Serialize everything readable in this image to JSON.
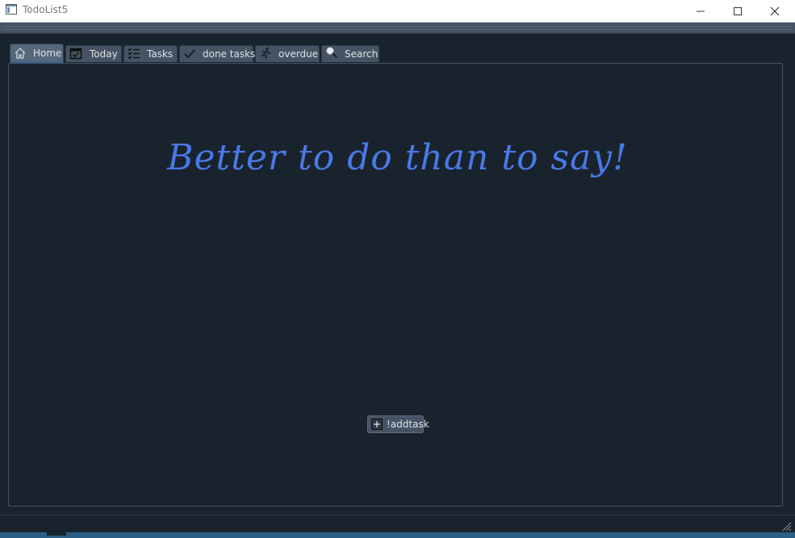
{
  "window": {
    "title": "TodoList5",
    "icon": "app-window-icon",
    "controls": {
      "minimize": "minimize-icon",
      "maximize": "maximize-icon",
      "close": "close-icon"
    }
  },
  "tabs": [
    {
      "label": "Home",
      "icon": "home-icon",
      "active": true
    },
    {
      "label": "Today",
      "icon": "calendar-check-icon",
      "active": false
    },
    {
      "label": "Tasks",
      "icon": "checklist-icon",
      "active": false
    },
    {
      "label": "done tasks",
      "icon": "checkmark-icon",
      "active": false
    },
    {
      "label": "overdue",
      "icon": "running-person-icon",
      "active": false
    },
    {
      "label": "Search",
      "icon": "search-icon",
      "active": false
    }
  ],
  "home": {
    "slogan": "Better to do than to say!",
    "add_button_label": "!addtask",
    "add_button_icon": "plus-box-icon"
  },
  "colors": {
    "background": "#19232d",
    "tab_bg": "#455364",
    "accent": "#346792",
    "slogan": "#4a78e6"
  }
}
